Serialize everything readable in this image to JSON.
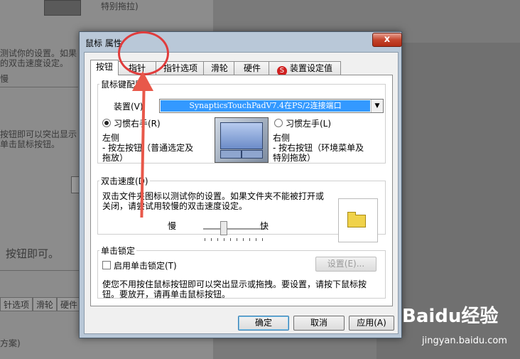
{
  "background": {
    "texts": [
      "特别拖拉)",
      "测试你的设置。如果",
      "的双击速度设定。",
      "慢",
      "按钮即可以突出显示",
      "单击鼠标按钮。",
      "按钮即可。",
      "方案)"
    ],
    "tabs": [
      "针选项",
      "滑轮",
      "硬件"
    ]
  },
  "dialog": {
    "title": "鼠标 属性",
    "close_label": "x",
    "tabs": [
      {
        "label": "按钮"
      },
      {
        "label": "指针"
      },
      {
        "label": "指针选项"
      },
      {
        "label": "滑轮"
      },
      {
        "label": "硬件"
      },
      {
        "label": "装置设定值",
        "icon": "S"
      }
    ],
    "button_config": {
      "legend": "鼠标键配置",
      "device_label": "装置(V)",
      "device_value": "SynapticsTouchPadV7.4在PS/2连接端口",
      "right_handed": "习惯右手(R)",
      "left_handed": "习惯左手(L)",
      "left_title": "左侧",
      "left_desc_1": "- 按左按钮（普通选定及",
      "left_desc_2": "拖放）",
      "right_title": "右侧",
      "right_desc_1": "- 按右按钮（环境菜单及",
      "right_desc_2": "特别拖放）"
    },
    "double_click": {
      "legend": "双击速度(D)",
      "desc_1": "双击文件夹图标以测试你的设置。如果文件夹不能被打开或",
      "desc_2": "关闭，请尝试用较慢的双击速度设定。",
      "slow": "慢",
      "fast": "快",
      "speed_fraction": 0.3
    },
    "click_lock": {
      "legend": "单击锁定",
      "enable": "启用单击锁定(T)",
      "settings_button": "设置(E)...",
      "desc_1": "使您不用按住鼠标按钮即可以突出显示或拖拽。要设置，请按下鼠标按",
      "desc_2": "钮。要放开，请再单击鼠标按钮。"
    },
    "buttons": {
      "ok": "确定",
      "cancel": "取消",
      "apply": "应用(A)"
    }
  },
  "watermark": {
    "brand": "Baidu经验",
    "url": "jingyan.baidu.com"
  }
}
